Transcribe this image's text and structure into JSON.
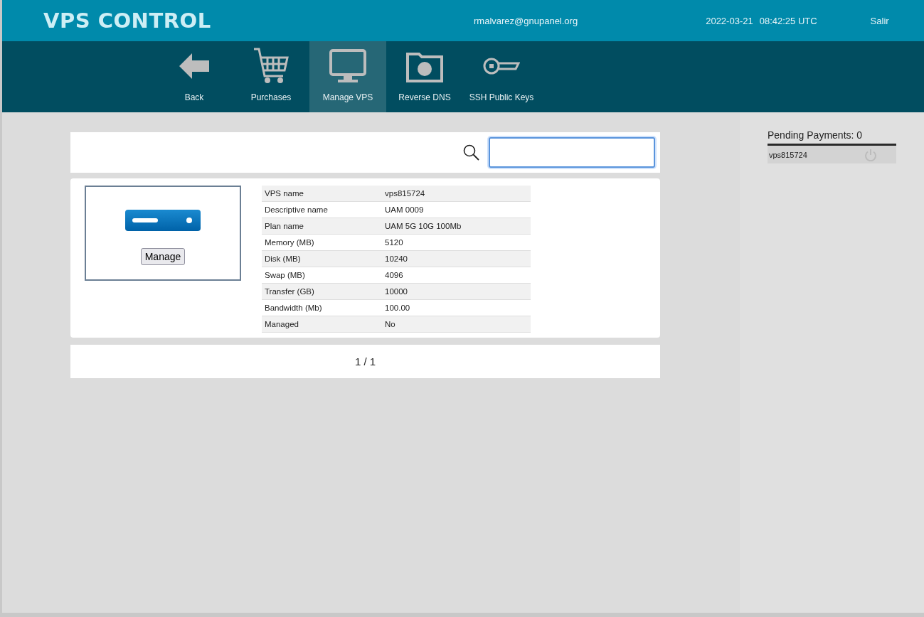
{
  "header": {
    "title": "VPS CONTROL",
    "user": "rmalvarez@gnupanel.org",
    "date": "2022-03-21",
    "time": "08:42:25 UTC",
    "logout": "Salir"
  },
  "nav": [
    {
      "label": "Back",
      "kind": "back",
      "selected": false
    },
    {
      "label": "Purchases",
      "kind": "cart",
      "selected": false
    },
    {
      "label": "Manage VPS",
      "kind": "monitor",
      "selected": true
    },
    {
      "label": "Reverse DNS",
      "kind": "dns",
      "selected": false
    },
    {
      "label": "SSH Public Keys",
      "kind": "key",
      "selected": false
    }
  ],
  "vps": {
    "button": "Manage",
    "details": [
      {
        "label": "VPS name",
        "value": "vps815724"
      },
      {
        "label": "Descriptive name",
        "value": "UAM 0009"
      },
      {
        "label": "Plan name",
        "value": "UAM 5G 10G 100Mb"
      },
      {
        "label": "Memory (MB)",
        "value": "5120"
      },
      {
        "label": "Disk (MB)",
        "value": "10240"
      },
      {
        "label": "Swap (MB)",
        "value": "4096"
      },
      {
        "label": "Transfer (GB)",
        "value": "10000"
      },
      {
        "label": "Bandwidth (Mb)",
        "value": "100.00"
      },
      {
        "label": "Managed",
        "value": "No"
      }
    ]
  },
  "pager": "1 / 1",
  "sidebar": {
    "title": "Pending Payments: 0",
    "items": [
      {
        "name": "vps815724"
      }
    ]
  }
}
